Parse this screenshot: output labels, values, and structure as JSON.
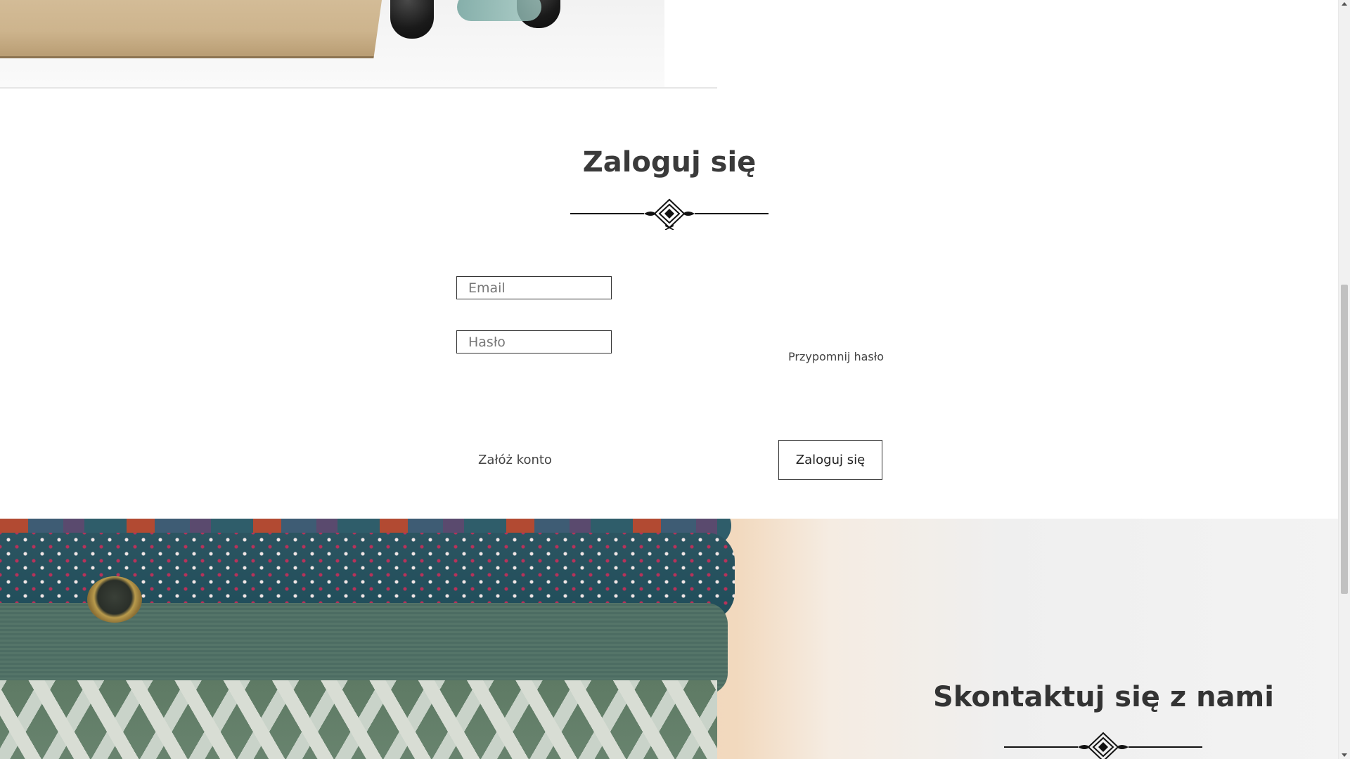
{
  "login": {
    "title": "Zaloguj się",
    "email_placeholder": "Email",
    "password_placeholder": "Hasło",
    "forgot_password": "Przypomnij hasło",
    "register_link": "Załóż konto",
    "submit_label": "Zaloguj się"
  },
  "contact": {
    "title": "Skontaktuj się z nami"
  },
  "icons": {
    "ornament": "decorative-divider-icon",
    "scroll_up": "chevron-up-icon",
    "scroll_down": "chevron-down-icon"
  },
  "colors": {
    "text": "#333333",
    "border": "#333333",
    "background": "#ffffff"
  }
}
